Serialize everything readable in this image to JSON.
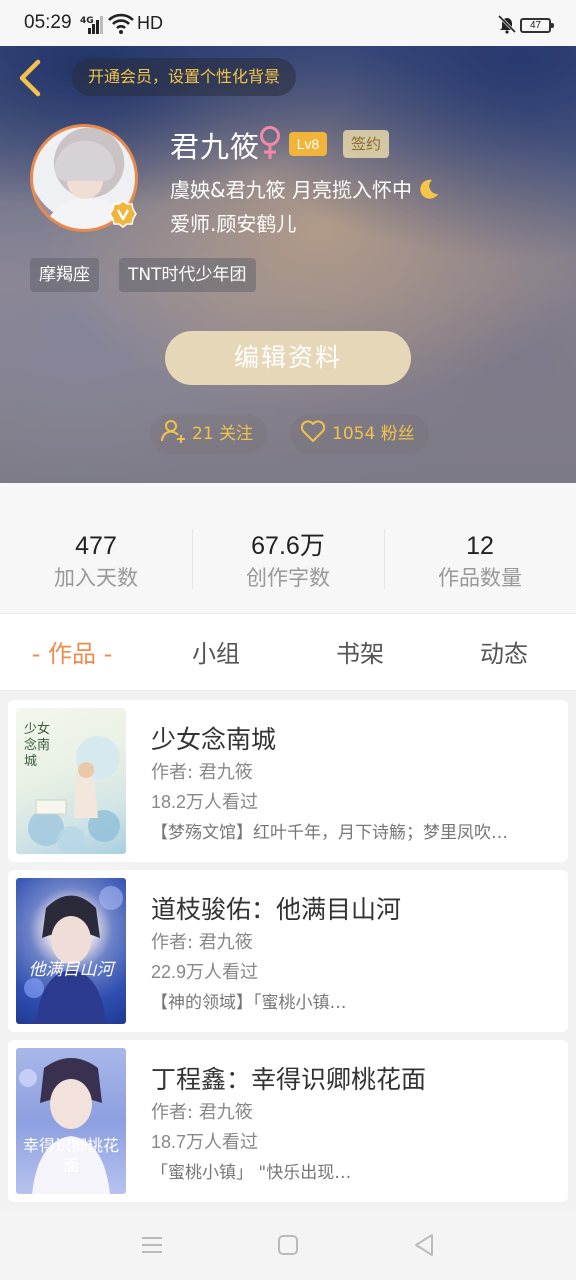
{
  "status_bar": {
    "time": "05:29",
    "network": "4G",
    "hd": "HD",
    "battery": "47"
  },
  "header": {
    "vip_banner": "开通会员，设置个性化背景",
    "username": "君九筱",
    "level": "Lv8",
    "sign_badge": "签约",
    "bio_line1": "虞姎&君九筱  月亮揽入怀中",
    "bio_line2": "爱师.顾安鹤儿",
    "tags": [
      "摩羯座",
      "TNT时代少年团"
    ],
    "edit_button": "编辑资料",
    "following": "21 关注",
    "fans": "1054 粉丝"
  },
  "stats": [
    {
      "value": "477",
      "label": "加入天数"
    },
    {
      "value": "67.6万",
      "label": "创作字数"
    },
    {
      "value": "12",
      "label": "作品数量"
    }
  ],
  "tabs": [
    "- 作品 -",
    "小组",
    "书架",
    "动态"
  ],
  "books": [
    {
      "title": "少女念南城",
      "author": "作者: 君九筱",
      "views": "18.2万人看过",
      "desc": "【梦殇文馆】红叶千年，月下诗觞；梦里凤吹…",
      "cover_text": "少女念南城"
    },
    {
      "title": "道枝骏佑：他满目山河",
      "author": "作者: 君九筱",
      "views": "22.9万人看过",
      "desc": "【神的领域】「蜜桃小镇…",
      "cover_text": "他满目山河"
    },
    {
      "title": "丁程鑫：幸得识卿桃花面",
      "author": "作者: 君九筱",
      "views": "18.7万人看过",
      "desc": "「蜜桃小镇」 \"快乐出现…",
      "cover_text": "幸得识卿桃花面"
    }
  ],
  "colors": {
    "accent": "#ef8c4c",
    "gold": "#f2c24c",
    "edit_button_bg": "#e6d7b8"
  }
}
